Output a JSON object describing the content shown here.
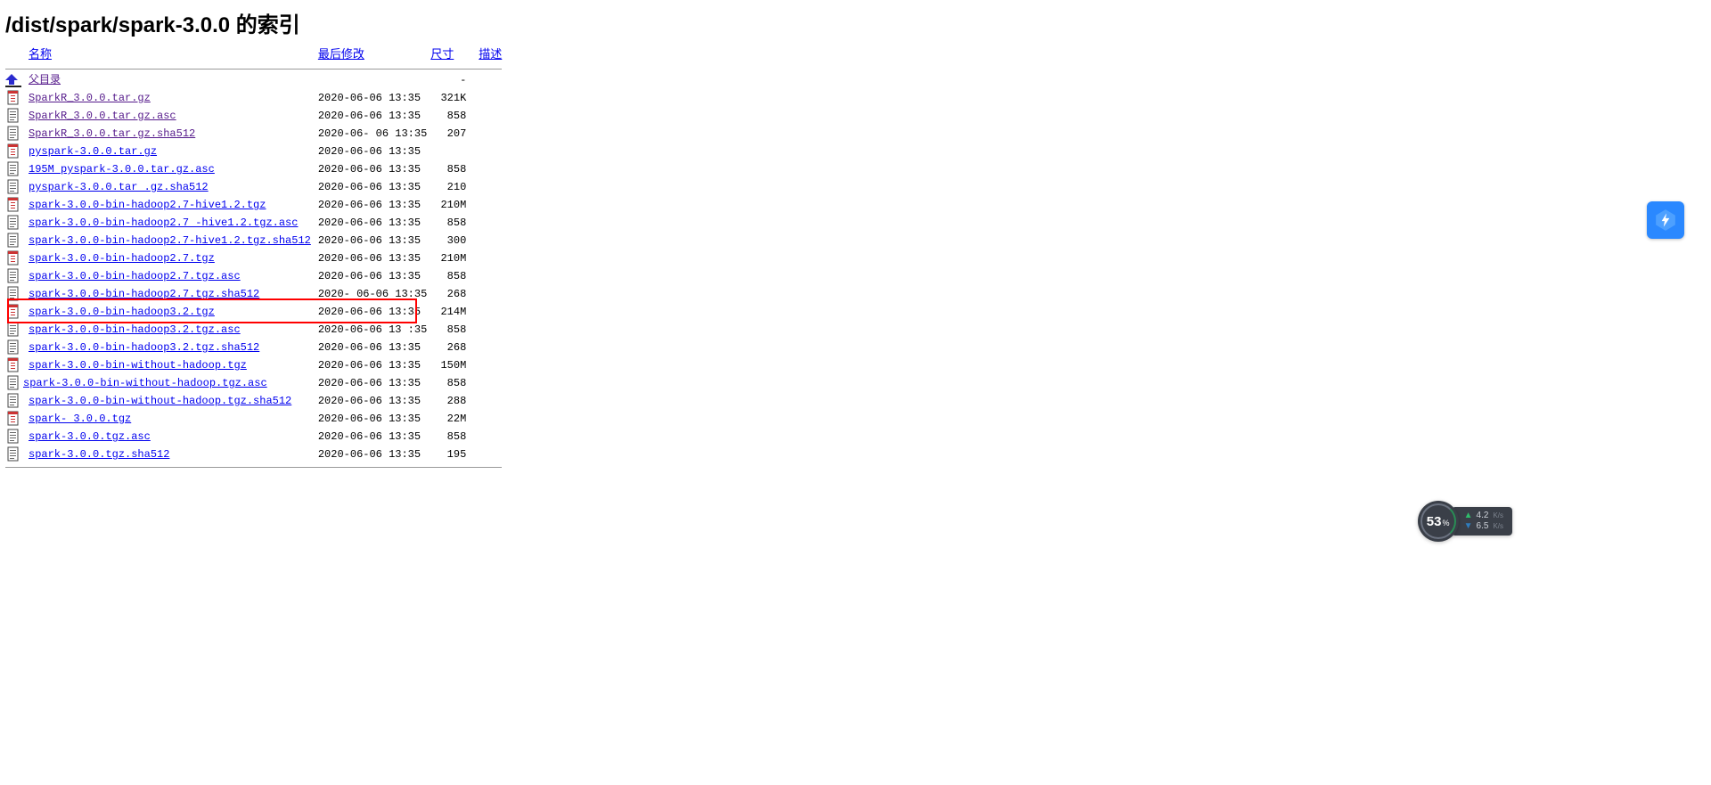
{
  "title": "/dist/spark/spark-3.0.0 的索引",
  "headers": {
    "name": "名称",
    "modified": "最后修改",
    "size": "尺寸",
    "desc": "描述"
  },
  "parent_label": "父目录",
  "parent_size": "-",
  "rows": [
    {
      "icon": "archive",
      "name": "SparkR_3.0.0.tar.gz",
      "date": "2020-06-06 13:35",
      "size": "321K",
      "visited": true
    },
    {
      "icon": "text",
      "name": "SparkR_3.0.0.tar.gz.asc",
      "date": "2020-06-06 13:35",
      "size": "858",
      "visited": true
    },
    {
      "icon": "text",
      "name": "SparkR_3.0.0.tar.gz.sha512",
      "date": "2020-06- 06 13:35",
      "size": "207",
      "visited": true
    },
    {
      "icon": "archive",
      "name": "pyspark-3.0.0.tar.gz",
      "date": "2020-06-06 13:35",
      "size": "",
      "visited": false
    },
    {
      "icon": "text",
      "name": "195M pyspark-3.0.0.tar.gz.asc",
      "date": "     2020-06-06 13:35",
      "size": "858",
      "visited": false
    },
    {
      "icon": "text",
      "name": "pyspark-3.0.0.tar .gz.sha512",
      "date": " 2020-06-06 13:35",
      "size": "210",
      "visited": false
    },
    {
      "icon": "archive",
      "name": "spark-3.0.0-bin-hadoop2.7-hive1.2.tgz",
      "date": "2020-06-06 13:35",
      "size": "210M",
      "visited": false
    },
    {
      "icon": "text",
      "name": "spark-3.0.0-bin-hadoop2.7 -hive1.2.tgz.asc",
      "date": "2020-06-06 13:35",
      "size": "858",
      "visited": false
    },
    {
      "icon": "text",
      "name": "spark-3.0.0-bin-hadoop2.7-hive1.2.tgz.sha512",
      "date": "2020-06-06 13:35",
      "size": "300",
      "visited": false
    },
    {
      "icon": "archive",
      "name": "spark-3.0.0-bin-hadoop2.7.tgz",
      "date": "2020-06-06 13:35",
      "size": "210M",
      "visited": false
    },
    {
      "icon": "text",
      "name": "spark-3.0.0-bin-hadoop2.7.tgz.asc",
      "date": "2020-06-06 13:35",
      "size": "858",
      "visited": false
    },
    {
      "icon": "text",
      "name": "spark-3.0.0-bin-hadoop2.7.tgz.sha512",
      "date": "2020- 06-06 13:35",
      "size": "268",
      "visited": false
    },
    {
      "icon": "archive",
      "name": "spark-3.0.0-bin-hadoop3.2.tgz",
      "date": "2020-06-06 13:35",
      "size": "214M",
      "visited": false,
      "highlight": true
    },
    {
      "icon": "text",
      "name": "spark-3.0.0-bin-hadoop3.2.tgz.asc",
      "date": "2020-06-06 13 :35",
      "size": "858",
      "visited": false
    },
    {
      "icon": "text",
      "name": "spark-3.0.0-bin-hadoop3.2.tgz.sha512",
      "date": "2020-06-06 13:35",
      "size": "268",
      "visited": false
    },
    {
      "icon": "archive",
      "name": "spark-3.0.0-bin-without-hadoop.tgz",
      "date": "2020-06-06 13:35",
      "size": "150M",
      "visited": false
    },
    {
      "icon": "text",
      "name": "spark-3.0.0-bin-without-hadoop.tgz.asc",
      "date": "2020-06-06 13:35",
      "size": "858",
      "visited": false,
      "outdent": true
    },
    {
      "icon": "text",
      "name": "spark-3.0.0-bin-without-hadoop.tgz.sha512",
      "date": "2020-06-06 13:35",
      "size": "288",
      "visited": false
    },
    {
      "icon": "archive",
      "name": "spark- 3.0.0.tgz",
      "date": " 2020-06-06 13:35",
      "size": "22M",
      "visited": false
    },
    {
      "icon": "text",
      "name": "spark-3.0.0.tgz.asc",
      "date": "2020-06-06 13:35",
      "size": "858",
      "visited": false
    },
    {
      "icon": "text",
      "name": "spark-3.0.0.tgz.sha512",
      "date": "2020-06-06 13:35",
      "size": "195",
      "visited": false
    }
  ],
  "icons": {
    "archive": "archive-icon",
    "text": "text-icon",
    "back": "back-icon"
  },
  "net": {
    "percent": "53",
    "up": "4.2",
    "down": "6.5",
    "unit": "K/s"
  },
  "colors": {
    "link": "#0000EE",
    "visited": "#551A8B",
    "highlight": "#ff0000",
    "badge": "#2a88ff"
  }
}
